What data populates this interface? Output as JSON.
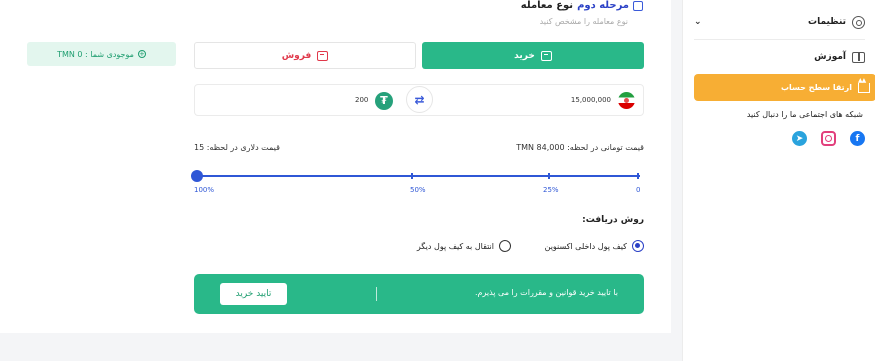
{
  "header": {
    "step_label": "مرحله دوم",
    "step_title": "نوع معامله",
    "subtitle": "نوع معامله را مشخص کنید"
  },
  "balance": {
    "text": "موجودی شما : TMN 0"
  },
  "trade_tabs": {
    "buy": "خرید",
    "sell": "فروش",
    "active": "buy"
  },
  "exchange": {
    "irr_amount": "15,000,000",
    "usdt_amount": "200"
  },
  "prices": {
    "toman": "قیمت تومانی در لحظه: TMN 84,000",
    "dollar": "قیمت دلاری در لحظه: 15"
  },
  "slider": {
    "ticks": [
      "100%",
      "50%",
      "25%",
      "0"
    ],
    "value_percent": 100
  },
  "receive_method": {
    "title": "روش دریافت:",
    "options": [
      {
        "label": "کیف پول داخلی اکسنوین",
        "selected": true
      },
      {
        "label": "انتقال به کیف پول دیگر",
        "selected": false
      }
    ]
  },
  "confirm": {
    "terms": "با تایید خرید قوانین و مقررات را می پذیرم.",
    "button": "تایید خرید"
  },
  "sidebar": {
    "settings": "تنظیمات",
    "learn": "آموزش",
    "upgrade": "ارتقا سطح حساب",
    "follow": "شبکه های اجتماعی ما را دنبال کنید",
    "socials": [
      "telegram-icon",
      "instagram-icon",
      "facebook-icon"
    ]
  },
  "colors": {
    "accent_green": "#29b889",
    "accent_blue": "#2f57d6",
    "sell_red": "#e0384a",
    "upgrade_orange": "#f7ae34"
  }
}
